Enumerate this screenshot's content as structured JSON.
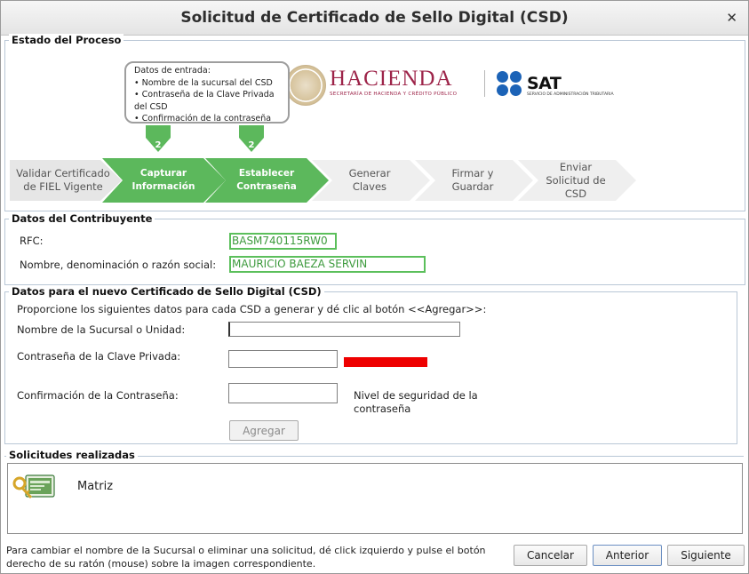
{
  "window": {
    "title": "Solicitud de Certificado de Sello Digital (CSD)",
    "close_glyph": "✕"
  },
  "process": {
    "legend": "Estado del Proceso",
    "logos": {
      "hacienda_word": "HACIENDA",
      "hacienda_sub": "SECRETARÍA DE HACIENDA Y CRÉDITO PÚBLICO",
      "sat_word": "SAT",
      "sat_sub": "SERVICIO DE ADMINISTRACIÓN TRIBUTARIA"
    },
    "bubble": {
      "heading": "Datos de entrada:",
      "items": [
        "• Nombre de la sucursal del CSD",
        "• Contraseña de la Clave Privada",
        "del CSD",
        "• Confirmación de la contraseña"
      ]
    },
    "arrow_numbers": [
      "2",
      "2"
    ],
    "steps": [
      {
        "label1": "Validar Certificado",
        "label2": "de FIEL Vigente",
        "label3": "",
        "state": "done-gray"
      },
      {
        "label1": "Capturar",
        "label2": "Información",
        "label3": "",
        "state": "active"
      },
      {
        "label1": "Establecer",
        "label2": "Contraseña",
        "label3": "",
        "state": "active"
      },
      {
        "label1": "Generar",
        "label2": "Claves",
        "label3": "",
        "state": "pending"
      },
      {
        "label1": "Firmar y",
        "label2": "Guardar",
        "label3": "",
        "state": "pending"
      },
      {
        "label1": "Enviar",
        "label2": "Solicitud de",
        "label3": "CSD",
        "state": "pending"
      }
    ],
    "colors": {
      "active": "#5cb85c",
      "pending": "#efefef",
      "first": "#e6e6e6"
    }
  },
  "taxpayer": {
    "legend": "Datos del Contribuyente",
    "rfc_label": "RFC:",
    "rfc_value": "BASM740115RW0",
    "name_label": "Nombre, denominación o razón social:",
    "name_value": "MAURICIO BAEZA SERVIN"
  },
  "new_cert": {
    "legend": "Datos para el nuevo Certificado de Sello Digital (CSD)",
    "instructions": "Proporcione los siguientes datos para cada CSD a generar y dé clic al botón <<Agregar>>:",
    "branch_label": "Nombre de la Sucursal o Unidad:",
    "branch_value": "",
    "password_label": "Contraseña de la Clave Privada:",
    "password_value": "",
    "confirm_label": "Confirmación de la Contraseña:",
    "confirm_value": "",
    "strength_label_1": "Nivel de seguridad de la",
    "strength_label_2": "contraseña",
    "strength_color": "#ee0000",
    "add_button": "Agregar"
  },
  "requests": {
    "legend": "Solicitudes realizadas",
    "items": [
      {
        "label": "Matriz"
      }
    ]
  },
  "footer": {
    "note_1": "Para cambiar el nombre de la Sucursal o eliminar una solicitud, dé click izquierdo y pulse el botón",
    "note_2": "derecho de su ratón (mouse) sobre la imagen correspondiente.",
    "cancel": "Cancelar",
    "back": "Anterior",
    "next": "Siguiente"
  }
}
